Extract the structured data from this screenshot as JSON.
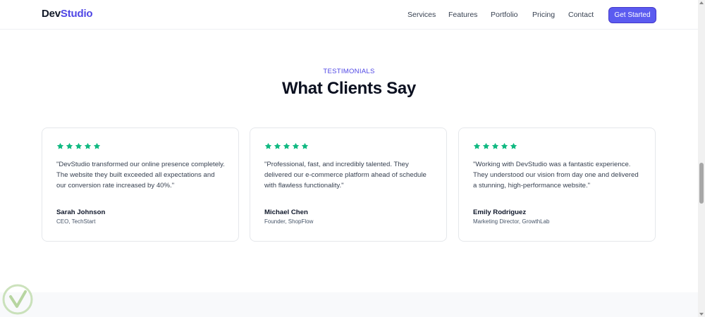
{
  "nav": {
    "logo_part1": "Dev",
    "logo_part2": "Studio",
    "links": [
      "Services",
      "Features",
      "Portfolio",
      "Pricing",
      "Contact"
    ],
    "cta_label": "Get Started"
  },
  "section": {
    "eyebrow": "TESTIMONIALS",
    "title": "What Clients Say"
  },
  "testimonials": [
    {
      "rating": 5,
      "quote": "\"DevStudio transformed our online presence completely. The website they built exceeded all expectations and our conversion rate increased by 40%.\"",
      "name": "Sarah Johnson",
      "role": "CEO, TechStart"
    },
    {
      "rating": 5,
      "quote": "\"Professional, fast, and incredibly talented. They delivered our e-commerce platform ahead of schedule with flawless functionality.\"",
      "name": "Michael Chen",
      "role": "Founder, ShopFlow"
    },
    {
      "rating": 5,
      "quote": "\"Working with DevStudio was a fantastic experience. They understood our vision from day one and delivered a stunning, high-performance website.\"",
      "name": "Emily Rodriguez",
      "role": "Marketing Director, GrowthLab"
    }
  ],
  "colors": {
    "brand": "#4f46e5",
    "cta": "#5b5bf0",
    "star": "#10b981",
    "heading": "#0b1020"
  },
  "icons": {
    "rating": "star-icon",
    "watermark": "check-shield-icon"
  }
}
